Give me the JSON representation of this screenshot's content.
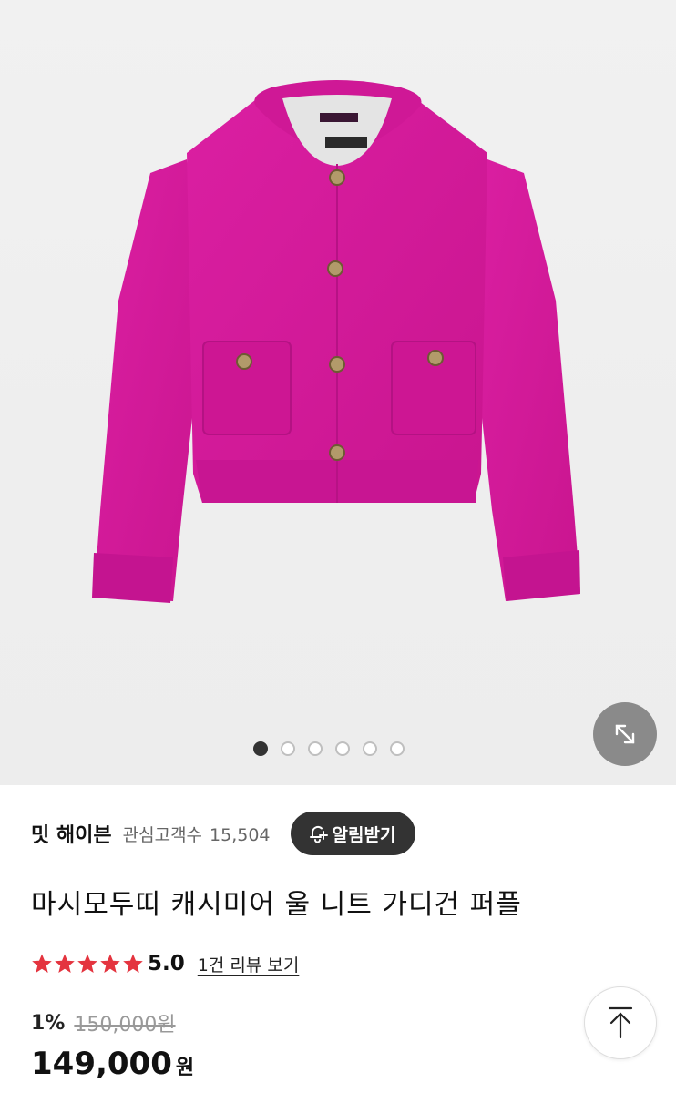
{
  "gallery": {
    "image_alt": "pink cardigan",
    "slide_count": 6,
    "active_slide": 1
  },
  "seller": {
    "name": "밋 해이븐",
    "watchers_label": "관심고객수",
    "watchers_count": "15,504",
    "alarm_label": "알림받기"
  },
  "product": {
    "title": "마시모두띠 캐시미어 울 니트 가디건 퍼플",
    "rating": "5.0",
    "stars": 5,
    "review_link": "1건 리뷰 보기",
    "discount": "1%",
    "original_price": "150,000원",
    "price": "149,000",
    "price_unit": "원"
  },
  "colors": {
    "star": "#e4343f",
    "cardigan": "#d2189a",
    "dark_button": "#333333"
  },
  "icons": {
    "expand": "expand-icon",
    "bell": "bell-plus-icon",
    "star": "star-icon",
    "top": "arrow-up-icon"
  }
}
